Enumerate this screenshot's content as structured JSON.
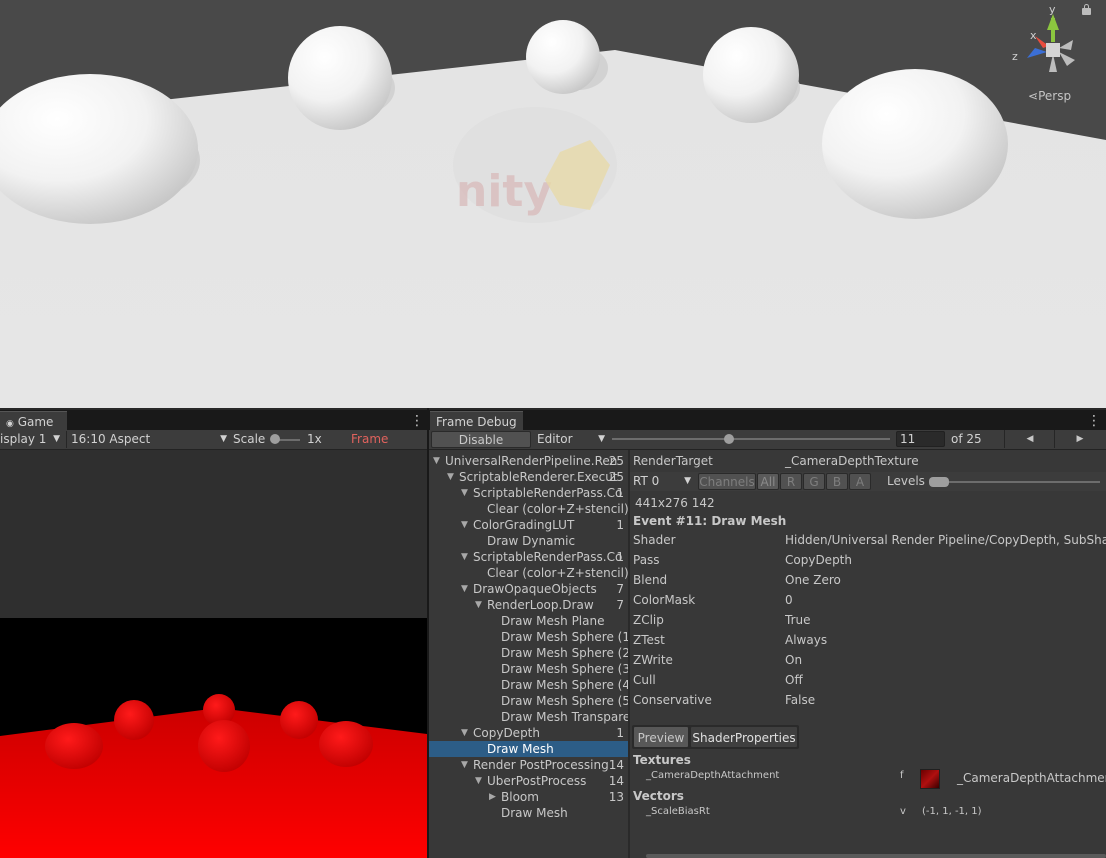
{
  "scene": {
    "view_mode": "Persp",
    "gizmo_axes": [
      "y",
      "x",
      "z"
    ]
  },
  "game": {
    "tab_label": "Game",
    "display": "isplay 1",
    "aspect": "16:10 Aspect",
    "scale_label": "Scale",
    "scale_value": "1x",
    "frame_debug_label": "Frame Debug"
  },
  "frame_debugger": {
    "tab_label": "Frame Debug",
    "disable_button": "Disable",
    "target_dropdown": "Editor",
    "event_index": "11",
    "event_total": "of 25",
    "tree": [
      {
        "label": "UniversalRenderPipeline.Ren",
        "count": "25",
        "depth": 0,
        "expand": "open"
      },
      {
        "label": "ScriptableRenderer.Execut",
        "count": "25",
        "depth": 1,
        "expand": "open"
      },
      {
        "label": "ScriptableRenderPass.Co",
        "count": "1",
        "depth": 2,
        "expand": "open"
      },
      {
        "label": "Clear (color+Z+stencil)",
        "count": "",
        "depth": 3,
        "expand": "none"
      },
      {
        "label": "ColorGradingLUT",
        "count": "1",
        "depth": 2,
        "expand": "open"
      },
      {
        "label": "Draw Dynamic",
        "count": "",
        "depth": 3,
        "expand": "none"
      },
      {
        "label": "ScriptableRenderPass.Co",
        "count": "1",
        "depth": 2,
        "expand": "open"
      },
      {
        "label": "Clear (color+Z+stencil)",
        "count": "",
        "depth": 3,
        "expand": "none"
      },
      {
        "label": "DrawOpaqueObjects",
        "count": "7",
        "depth": 2,
        "expand": "open"
      },
      {
        "label": "RenderLoop.Draw",
        "count": "7",
        "depth": 3,
        "expand": "open"
      },
      {
        "label": "Draw Mesh Plane",
        "count": "",
        "depth": 4,
        "expand": "none"
      },
      {
        "label": "Draw Mesh Sphere (1)",
        "count": "",
        "depth": 4,
        "expand": "none"
      },
      {
        "label": "Draw Mesh Sphere (2)",
        "count": "",
        "depth": 4,
        "expand": "none"
      },
      {
        "label": "Draw Mesh Sphere (3)",
        "count": "",
        "depth": 4,
        "expand": "none"
      },
      {
        "label": "Draw Mesh Sphere (4)",
        "count": "",
        "depth": 4,
        "expand": "none"
      },
      {
        "label": "Draw Mesh Sphere (5)",
        "count": "",
        "depth": 4,
        "expand": "none"
      },
      {
        "label": "Draw Mesh Transparer",
        "count": "",
        "depth": 4,
        "expand": "none"
      },
      {
        "label": "CopyDepth",
        "count": "1",
        "depth": 2,
        "expand": "open"
      },
      {
        "label": "Draw Mesh",
        "count": "",
        "depth": 3,
        "expand": "none",
        "selected": true
      },
      {
        "label": "Render PostProcessing",
        "count": "14",
        "depth": 2,
        "expand": "open"
      },
      {
        "label": "UberPostProcess",
        "count": "14",
        "depth": 3,
        "expand": "open"
      },
      {
        "label": "Bloom",
        "count": "13",
        "depth": 4,
        "expand": "closed"
      },
      {
        "label": "Draw Mesh",
        "count": "",
        "depth": 4,
        "expand": "none"
      }
    ],
    "render_target_label": "RenderTarget",
    "render_target_value": "_CameraDepthTexture",
    "rt_dropdown": "RT 0",
    "channels_label": "Channels",
    "channels": [
      "All",
      "R",
      "G",
      "B",
      "A"
    ],
    "levels_label": "Levels",
    "size_info": "441x276 142",
    "event_title": "Event #11: Draw Mesh",
    "properties": [
      {
        "key": "Shader",
        "value": "Hidden/Universal Render Pipeline/CopyDepth, SubShade"
      },
      {
        "key": "Pass",
        "value": "CopyDepth"
      },
      {
        "key": "Blend",
        "value": "One Zero"
      },
      {
        "key": "ColorMask",
        "value": "0"
      },
      {
        "key": "ZClip",
        "value": "True"
      },
      {
        "key": "ZTest",
        "value": "Always"
      },
      {
        "key": "ZWrite",
        "value": "On"
      },
      {
        "key": "Cull",
        "value": "Off"
      },
      {
        "key": "Conservative",
        "value": "False"
      }
    ],
    "detail_tabs": [
      "Preview",
      "ShaderProperties"
    ],
    "textures_header": "Textures",
    "textures": [
      {
        "name": "_CameraDepthAttachment",
        "stage": "f",
        "value": "_CameraDepthAttachment"
      }
    ],
    "vectors_header": "Vectors",
    "vectors": [
      {
        "name": "_ScaleBiasRt",
        "stage": "v",
        "value": "(-1, 1, -1, 1)"
      }
    ]
  },
  "colors": {
    "selection": "#2c5d87",
    "frame_debug_red": "#e0625d",
    "game_red": "#ff0000"
  }
}
